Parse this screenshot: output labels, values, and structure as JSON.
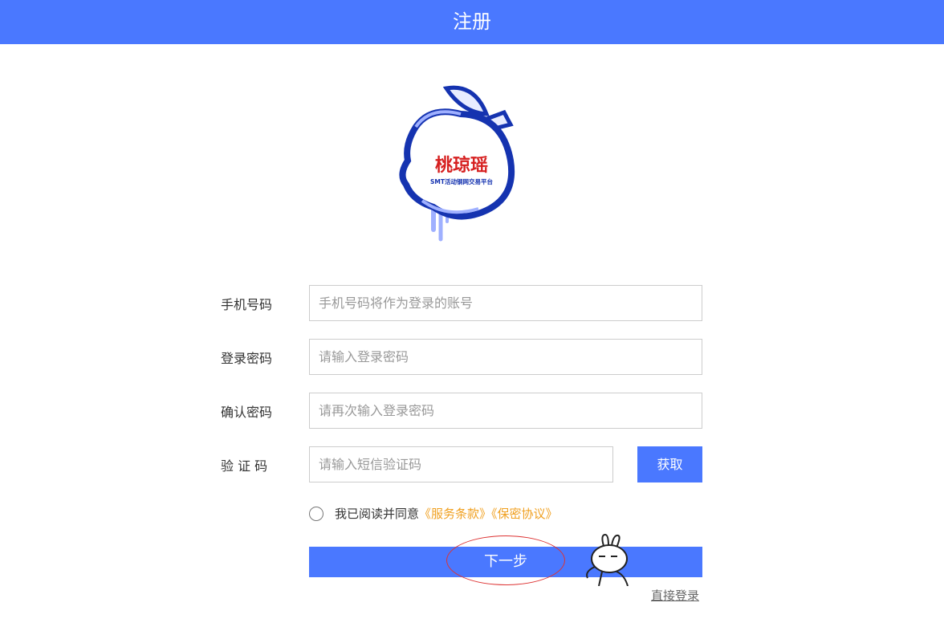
{
  "header": {
    "title": "注册"
  },
  "logo": {
    "brand_text": "桃琼瑶",
    "sub_text": "SMT活动钢网交易平台"
  },
  "form": {
    "phone": {
      "label": "手机号码",
      "placeholder": "手机号码将作为登录的账号"
    },
    "password": {
      "label": "登录密码",
      "placeholder": "请输入登录密码"
    },
    "confirm": {
      "label": "确认密码",
      "placeholder": "请再次输入登录密码"
    },
    "code": {
      "label": "验 证 码",
      "placeholder": "请输入短信验证码",
      "get_button": "获取"
    }
  },
  "agreement": {
    "text": "我已阅读并同意",
    "terms": "《服务条款》",
    "privacy": "《保密协议》"
  },
  "actions": {
    "next": "下一步",
    "direct_login": "直接登录"
  },
  "colors": {
    "accent": "#4a78ff",
    "link": "#f0a020",
    "highlight": "#dd3333"
  }
}
